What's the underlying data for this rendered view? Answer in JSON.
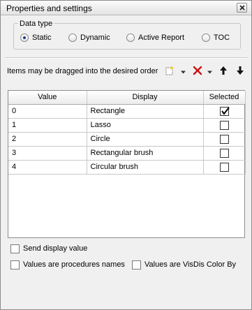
{
  "window": {
    "title": "Properties and settings"
  },
  "data_type": {
    "legend": "Data type",
    "options": [
      {
        "label": "Static",
        "selected": true
      },
      {
        "label": "Dynamic",
        "selected": false
      },
      {
        "label": "Active Report",
        "selected": false
      },
      {
        "label": "TOC",
        "selected": false
      }
    ]
  },
  "toolbar": {
    "hint": "Items may be dragged into the desired order",
    "icons": [
      "new-item-icon",
      "dropdown-arrow-icon",
      "delete-icon",
      "dropdown-arrow-icon",
      "move-up-icon",
      "move-down-icon"
    ]
  },
  "table": {
    "headers": [
      "Value",
      "Display",
      "Selected"
    ],
    "rows": [
      {
        "value": "0",
        "display": "Rectangle",
        "selected": true
      },
      {
        "value": "1",
        "display": "Lasso",
        "selected": false
      },
      {
        "value": "2",
        "display": "Circle",
        "selected": false
      },
      {
        "value": "3",
        "display": "Rectangular brush",
        "selected": false
      },
      {
        "value": "4",
        "display": "Circular brush",
        "selected": false
      }
    ]
  },
  "options": {
    "send_display_value": "Send display value",
    "procedures_names": "Values are procedures names",
    "visdis_color_by": "Values are VisDis Color By"
  },
  "colors": {
    "delete": "#cc1111",
    "window_bg": "#f0f0f0",
    "radio_dot": "#1d3f8a"
  }
}
